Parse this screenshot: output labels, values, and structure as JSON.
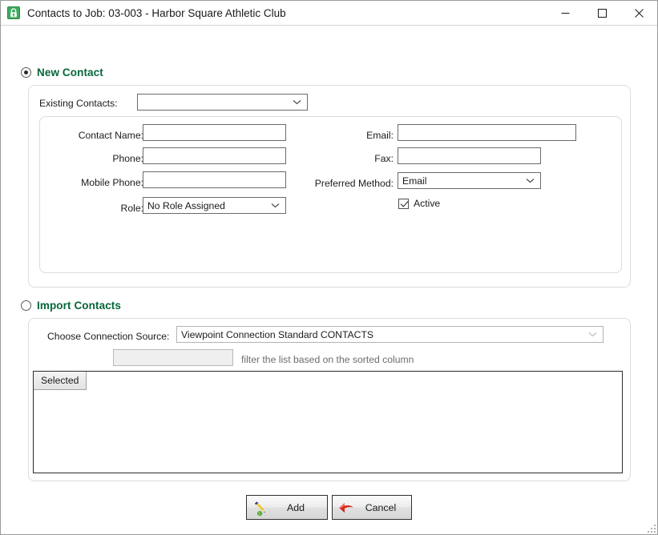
{
  "window": {
    "title": "Contacts to Job: 03-003 - Harbor Square Athletic Club",
    "icon": "contacts-lock-icon",
    "minimize_label": "—",
    "maximize_label": "□",
    "close_label": "✕",
    "accent_green": "#07663a"
  },
  "new_contact": {
    "radio_label": "New Contact",
    "selected": true,
    "existing_contacts": {
      "label": "Existing Contacts:",
      "value": "",
      "placeholder": ""
    },
    "fields": {
      "contact_name": {
        "label": "Contact Name:",
        "value": "",
        "placeholder": ""
      },
      "phone": {
        "label": "Phone:",
        "value": "",
        "placeholder": ""
      },
      "mobile_phone": {
        "label": "Mobile Phone:",
        "value": "",
        "placeholder": ""
      },
      "role": {
        "label": "Role:",
        "value": "No Role Assigned"
      },
      "email": {
        "label": "Email:",
        "value": "",
        "placeholder": ""
      },
      "fax": {
        "label": "Fax:",
        "value": "",
        "placeholder": ""
      },
      "preferred_method": {
        "label": "Preferred Method:",
        "value": "Email"
      },
      "active": {
        "label": "Active",
        "checked": true
      }
    }
  },
  "import_contacts": {
    "radio_label": "Import Contacts",
    "selected": false,
    "connection_source": {
      "label": "Choose Connection Source:",
      "value": "Viewpoint Connection Standard CONTACTS"
    },
    "filter": {
      "value": "",
      "placeholder": "",
      "hint": "filter the list based on the sorted column"
    },
    "list": {
      "columns": [
        "Selected"
      ],
      "rows": []
    }
  },
  "footer": {
    "add_label": "Add",
    "add_icon": "pen-plus-icon",
    "cancel_label": "Cancel",
    "cancel_icon": "red-back-arrow-icon"
  }
}
